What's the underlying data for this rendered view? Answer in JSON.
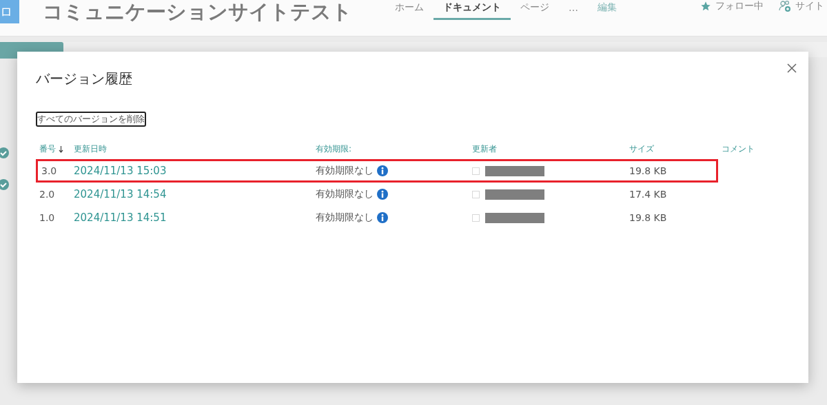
{
  "site": {
    "logo": "ロ",
    "title": "コミュニケーションサイトテスト",
    "nav": [
      {
        "label": "ホーム",
        "selected": false
      },
      {
        "label": "ドキュメント",
        "selected": true
      },
      {
        "label": "ページ",
        "selected": false
      },
      {
        "label": "…",
        "selected": false
      },
      {
        "label": "編集",
        "selected": false
      }
    ],
    "follow": "フォロー中",
    "site_access": "サイト"
  },
  "dialog": {
    "title": "バージョン履歴",
    "delete_all": "すべてのバージョンを削除",
    "columns": [
      "番号",
      "更新日時",
      "有効期限:",
      "更新者",
      "サイズ",
      "コメント"
    ],
    "rows": [
      {
        "version": "3.0",
        "modified": "2024/11/13 15:03",
        "expiration": "有効期限なし",
        "size": "19.8 KB",
        "highlighted": true
      },
      {
        "version": "2.0",
        "modified": "2024/11/13 14:54",
        "expiration": "有効期限なし",
        "size": "17.4 KB",
        "highlighted": false
      },
      {
        "version": "1.0",
        "modified": "2024/11/13 14:51",
        "expiration": "有効期限なし",
        "size": "19.8 KB",
        "highlighted": false
      }
    ]
  }
}
